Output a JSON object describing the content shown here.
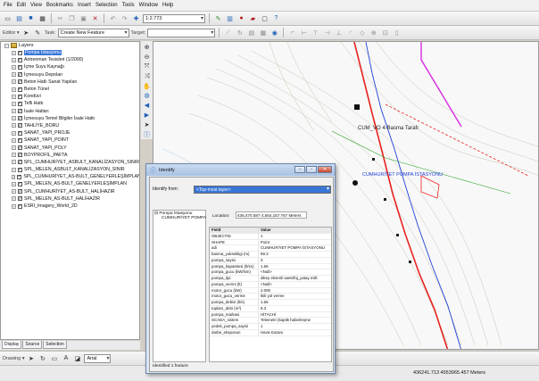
{
  "menu": [
    "File",
    "Edit",
    "View",
    "Bookmarks",
    "Insert",
    "Selection",
    "Tools",
    "Window",
    "Help"
  ],
  "toolbar": {
    "scale": "1:2.773"
  },
  "editor": {
    "label": "Editor ▾",
    "task_label": "Task:",
    "task_value": "Create New Feature",
    "target_label": "Target:"
  },
  "toc": {
    "root": "Layers",
    "layers": [
      "Pompa İstasyonu",
      "Antrenman Tesisleri (1/2000)",
      "İçme Suyu Kaynağı",
      "İçmesuyu Depoları",
      "Beton Hatlı Sanat Yapıları",
      "Beton Tünel",
      "Kondüvi",
      "Tefli Hattı",
      "İsale Hatları",
      "İçmesuyu Temel Bilgiler İsale Hattı",
      "TAHLİYE_BORU",
      "SANAT_YAPI_PROJE",
      "SANAT_YAPI_POINT",
      "SANAT_YAPI_POLY",
      "BOYPROFİL_PAFTA",
      "SPL_CUMHURİYET_ASBULT_KANALİZASYON_SINIR",
      "SPL_MELEN_ASBULT_KANALİZASYON_SINIR",
      "SPL_CUMHURİYET_AS-BULT_GENELYERLEŞİMPLAN",
      "SPL_MELEN_AS-BULT_GENELYERLEŞİMPLAN",
      "SPL_CUMHURİYET_AS-BULT_HALİHAZIR",
      "SPL_MELEN_AS-BULT_HALİHAZIR",
      "ESRI_Imagery_World_2D"
    ],
    "tabs": [
      "Display",
      "Source",
      "Selection"
    ]
  },
  "drawing": {
    "label": "Drawing ▾",
    "font": "Arial"
  },
  "status": {
    "coords": "436241.713  4553965.457 Meters"
  },
  "map": {
    "label_station": "CUM_VO 4-Basma Tarafı",
    "label_pump": "CUMHURİYET POMPA İSTASYONU",
    "colors": {
      "red": "#e8231f",
      "magenta": "#d72be0",
      "blue": "#1f40d8",
      "green": "#2aa32a"
    }
  },
  "identify": {
    "title": "Identify",
    "from_label": "Identify from:",
    "from_value": "<Top-most layer>",
    "tree_root": "Pompa İstasyonu",
    "tree_child": "CUMHURİYET POMPA",
    "location_label": "Location:",
    "location_value": "436,470.587  4,554,157.767 Meters",
    "col_field": "Field",
    "col_value": "Value",
    "rows": [
      [
        "OBJECTID",
        "1"
      ],
      [
        "SHAPE",
        "Point"
      ],
      [
        "adi",
        "CUMHURİYET POMPA İSTASYONU"
      ],
      [
        "basma_yuksekligi (m)",
        "99.3"
      ],
      [
        "pompa_sayisi",
        "3"
      ],
      [
        "pompa_kapasitesi (lt/sn)",
        "1.66"
      ],
      [
        "pompa_gucu (kW/lsm)",
        "<Null>"
      ],
      [
        "pompa_tipi",
        "dikey eksenli santrifüj_yatay milli"
      ],
      [
        "pompa_verimi (lt)",
        "<Null>"
      ],
      [
        "motor_gucu (kW)",
        "2.000"
      ],
      [
        "motor_gucu_verme",
        "İkili yol verme"
      ],
      [
        "pompa_debisi (lt/s)",
        "1.66"
      ],
      [
        "toplam_debi (m³)",
        "8.3"
      ],
      [
        "pompa_markasi",
        "HİTACHİ"
      ],
      [
        "SCADA_sistem",
        "Telemetri (kaptik haberleşme"
      ],
      [
        "yedek_pompa_sayisi",
        "1"
      ],
      [
        "darbe_eksposun",
        "Hava Kazanı"
      ]
    ],
    "status": "Identified 1 feature"
  }
}
